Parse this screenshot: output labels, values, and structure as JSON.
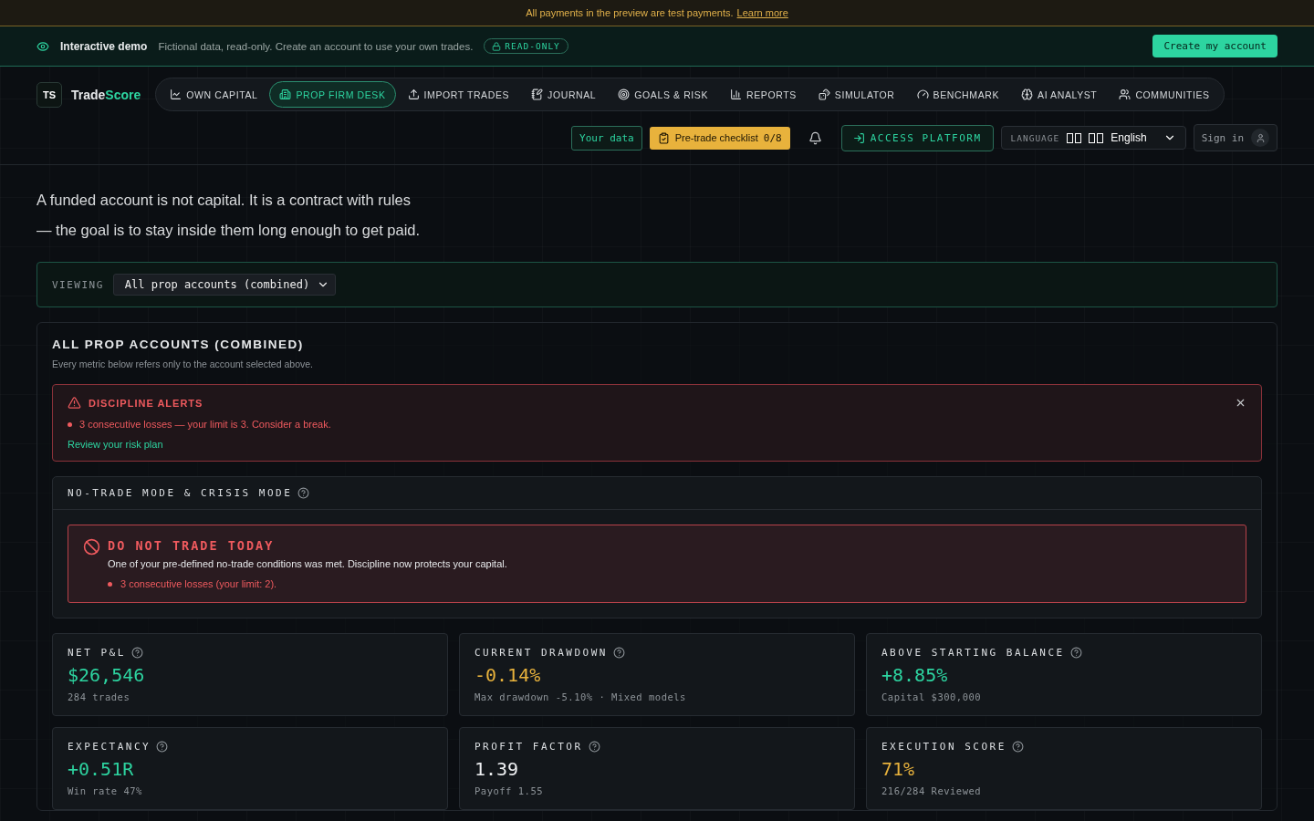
{
  "test_banner": {
    "text": "All payments in the preview are test payments.",
    "link": "Learn more"
  },
  "demo_bar": {
    "title": "Interactive demo",
    "description": "Fictional data, read-only. Create an account to use your own trades.",
    "badge": "READ-ONLY",
    "cta": "Create my account"
  },
  "brand": {
    "logo": "TS",
    "name_start": "Trade",
    "name_end": "Score"
  },
  "nav": [
    {
      "label": "OWN CAPITAL",
      "selected": false
    },
    {
      "label": "PROP FIRM DESK",
      "selected": true
    },
    {
      "label": "IMPORT TRADES",
      "selected": false
    },
    {
      "label": "JOURNAL",
      "selected": false
    },
    {
      "label": "GOALS & RISK",
      "selected": false
    },
    {
      "label": "REPORTS",
      "selected": false
    },
    {
      "label": "SIMULATOR",
      "selected": false
    },
    {
      "label": "BENCHMARK",
      "selected": false
    },
    {
      "label": "AI ANALYST",
      "selected": false
    },
    {
      "label": "COMMUNITIES",
      "selected": false
    }
  ],
  "toolbar": {
    "your_data": "Your data",
    "checklist": "Pre-trade checklist",
    "checklist_count": "0/8",
    "access": "ACCESS PLATFORM",
    "language_label": "LANGUAGE",
    "language": "English",
    "sign_in": "Sign in"
  },
  "intro": [
    "A funded account is not capital. It is a contract with rules",
    "— the goal is to stay inside them long enough to get paid."
  ],
  "viewing": {
    "label": "VIEWING",
    "value": "All prop accounts (combined)"
  },
  "panel": {
    "title": "ALL PROP ACCOUNTS (COMBINED)",
    "subtitle": "Every metric below refers only to the account selected above.",
    "alerts": {
      "title": "DISCIPLINE ALERTS",
      "items": [
        "3 consecutive losses — your limit is 3. Consider a break."
      ],
      "link": "Review your risk plan"
    },
    "crisis": {
      "title": "NO-TRADE MODE & CRISIS MODE",
      "banner_title": "DO NOT TRADE TODAY",
      "banner_text": "One of your pre-defined no-trade conditions was met. Discipline now protects your capital.",
      "reasons": [
        "3 consecutive losses (your limit: 2)."
      ]
    },
    "metrics": [
      {
        "label": "NET P&L",
        "value": "$26,546",
        "color": "#2dd4a0",
        "note": "284 trades"
      },
      {
        "label": "CURRENT DRAWDOWN",
        "value": "-0.14%",
        "color": "#e8b23c",
        "note": "Max drawdown -5.10% · Mixed models"
      },
      {
        "label": "ABOVE STARTING BALANCE",
        "value": "+8.85%",
        "color": "#2dd4a0",
        "note": "Capital $300,000"
      },
      {
        "label": "EXPECTANCY",
        "value": "+0.51R",
        "color": "#2dd4a0",
        "note": "Win rate 47%"
      },
      {
        "label": "PROFIT FACTOR",
        "value": "1.39",
        "color": "#eef0f2",
        "note": "Payoff 1.55"
      },
      {
        "label": "EXECUTION SCORE",
        "value": "71%",
        "color": "#e8b23c",
        "note": "216/284 Reviewed"
      }
    ]
  }
}
